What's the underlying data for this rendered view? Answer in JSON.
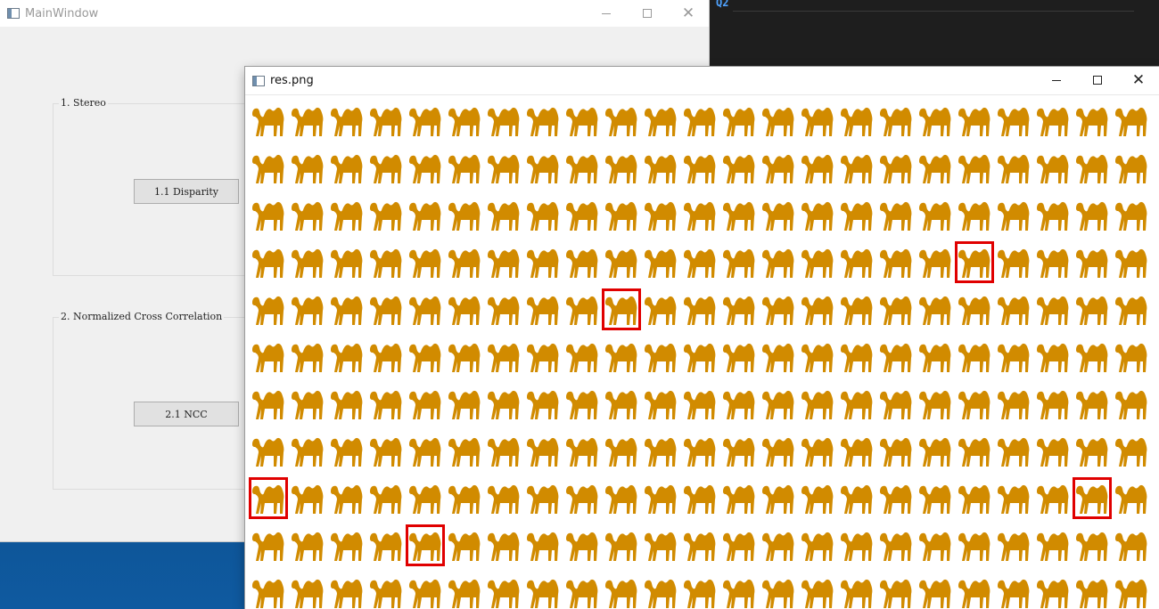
{
  "editor": {
    "snippet": "Q2"
  },
  "main_window": {
    "title": "MainWindow",
    "groups": [
      {
        "title": "1. Stereo",
        "button": "1.1 Disparity"
      },
      {
        "title": "2. Normalized Cross Correlation",
        "button": "2.1 NCC"
      }
    ]
  },
  "image_window": {
    "title": "res.png",
    "grid": {
      "rows": 11,
      "cols": 23
    },
    "camel_color": "#d18b00",
    "match_color": "#e00000",
    "matches": [
      {
        "row": 3,
        "col": 18
      },
      {
        "row": 4,
        "col": 9
      },
      {
        "row": 8,
        "col": 0
      },
      {
        "row": 8,
        "col": 21
      },
      {
        "row": 9,
        "col": 4
      }
    ]
  },
  "icons": {
    "app": "window-app-icon",
    "minimize": "minimize-icon",
    "maximize": "maximize-icon",
    "close": "close-icon"
  }
}
